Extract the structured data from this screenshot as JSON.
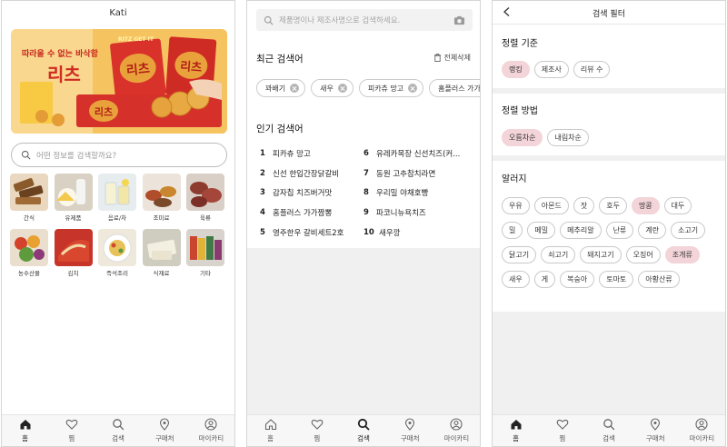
{
  "home": {
    "title": "Kati",
    "banner": {
      "tagline": "따라올 수 없는 바삭함",
      "brand": "리츠",
      "badge": "RITZ GET IT"
    },
    "search_placeholder": "어떤 정보를 검색할까요?",
    "categories": [
      {
        "label": "간식",
        "icon": "snack"
      },
      {
        "label": "유제품",
        "icon": "dairy"
      },
      {
        "label": "음료/차",
        "icon": "drink"
      },
      {
        "label": "조미료",
        "icon": "seasoning"
      },
      {
        "label": "육류",
        "icon": "meat"
      },
      {
        "label": "농수산물",
        "icon": "produce"
      },
      {
        "label": "김치",
        "icon": "kimchi"
      },
      {
        "label": "즉석조리",
        "icon": "instant"
      },
      {
        "label": "식재료",
        "icon": "ingredient"
      },
      {
        "label": "기타",
        "icon": "etc"
      }
    ]
  },
  "search": {
    "placeholder": "제품명이나 제조사명으로 검색하세요.",
    "recent_title": "최근 검색어",
    "clear_all": "전체삭제",
    "recent": [
      "꽈배기",
      "새우",
      "피카츄 망고",
      "홈플러스 가가짬뽕"
    ],
    "popular_title": "인기 검색어",
    "popular": [
      {
        "rank": "1",
        "text": "피카츄 망고"
      },
      {
        "rank": "2",
        "text": "신선 한입간장닭갈비"
      },
      {
        "rank": "3",
        "text": "감자칩 치즈버거맛"
      },
      {
        "rank": "4",
        "text": "홈플러스 가가짬뽕"
      },
      {
        "rank": "5",
        "text": "영주한우 갈비세트2호"
      },
      {
        "rank": "6",
        "text": "유레카목장 신선치즈(커..."
      },
      {
        "rank": "7",
        "text": "동원 고추참치라면"
      },
      {
        "rank": "8",
        "text": "우리밀 야채호빵"
      },
      {
        "rank": "9",
        "text": "파코니뉴욕치즈"
      },
      {
        "rank": "10",
        "text": "새우깡"
      }
    ]
  },
  "filter": {
    "title": "검색 필터",
    "sort_criteria_title": "정렬 기준",
    "sort_criteria": [
      {
        "label": "랭킹",
        "selected": true
      },
      {
        "label": "제조사",
        "selected": false
      },
      {
        "label": "리뷰 수",
        "selected": false
      }
    ],
    "sort_order_title": "정렬 방법",
    "sort_order": [
      {
        "label": "오름차순",
        "selected": true
      },
      {
        "label": "내림차순",
        "selected": false
      }
    ],
    "allergy_title": "알러지",
    "allergies": [
      {
        "label": "우유",
        "selected": false
      },
      {
        "label": "아몬드",
        "selected": false
      },
      {
        "label": "잣",
        "selected": false
      },
      {
        "label": "호두",
        "selected": false
      },
      {
        "label": "땅콩",
        "selected": true
      },
      {
        "label": "대두",
        "selected": false
      },
      {
        "label": "밀",
        "selected": false
      },
      {
        "label": "메밀",
        "selected": false
      },
      {
        "label": "메추리알",
        "selected": false
      },
      {
        "label": "난류",
        "selected": false
      },
      {
        "label": "계란",
        "selected": false
      },
      {
        "label": "소고기",
        "selected": false
      },
      {
        "label": "닭고기",
        "selected": false
      },
      {
        "label": "쇠고기",
        "selected": false
      },
      {
        "label": "돼지고기",
        "selected": false
      },
      {
        "label": "오징어",
        "selected": false
      },
      {
        "label": "조개류",
        "selected": true
      },
      {
        "label": "새우",
        "selected": false
      },
      {
        "label": "게",
        "selected": false
      },
      {
        "label": "복숭아",
        "selected": false
      },
      {
        "label": "토마토",
        "selected": false
      },
      {
        "label": "아황산류",
        "selected": false
      }
    ]
  },
  "nav": [
    {
      "label": "홈",
      "icon": "home-icon"
    },
    {
      "label": "찜",
      "icon": "heart-icon"
    },
    {
      "label": "검색",
      "icon": "search-icon"
    },
    {
      "label": "구매처",
      "icon": "location-pin-icon"
    },
    {
      "label": "마이카티",
      "icon": "user-icon"
    }
  ],
  "colors": {
    "chip_selected_bg": "#f3d4d8",
    "banner_bg": "#f3bd59",
    "banner_red": "#d9322b"
  }
}
